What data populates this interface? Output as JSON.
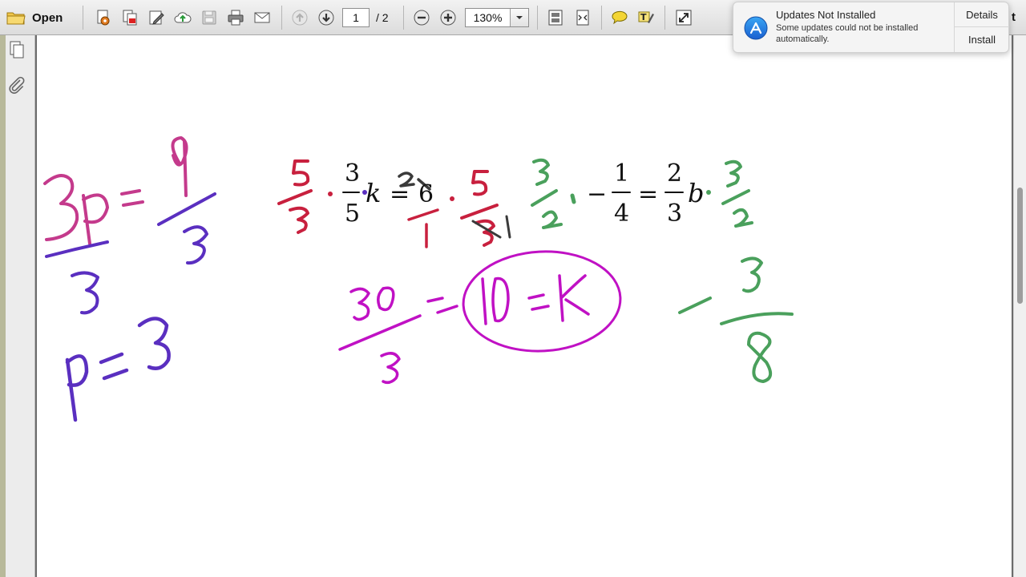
{
  "toolbar": {
    "open_label": "Open",
    "current_page": "1",
    "page_total": "/ 2",
    "zoom": "130%",
    "corner_text": "t"
  },
  "notification": {
    "title": "Updates Not Installed",
    "message": "Some updates could not be installed automatically.",
    "details_label": "Details",
    "install_label": "Install"
  },
  "document": {
    "typed_math": {
      "eq1_num": "3",
      "eq1_den": "5",
      "eq1_var": "k",
      "eq1_eq": "=",
      "eq1_rhs": "6",
      "eq2_neg": "−",
      "eq2_num1": "1",
      "eq2_den1": "4",
      "eq2_eq": "=",
      "eq2_num2": "2",
      "eq2_den2": "3",
      "eq2_var": "b"
    }
  },
  "colors": {
    "ink_pink": "#c43a8c",
    "ink_purple": "#5a2fc0",
    "ink_red": "#c8203e",
    "ink_magenta": "#c011c4",
    "ink_green": "#4aa05c",
    "ink_dark": "#3a3a3a"
  }
}
